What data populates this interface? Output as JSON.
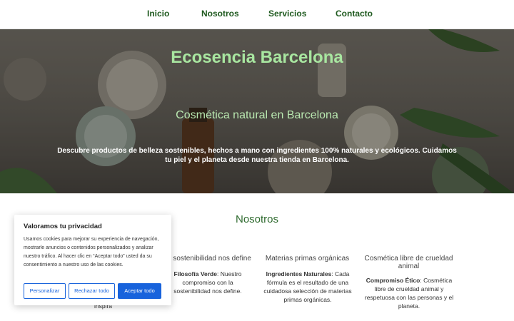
{
  "nav": {
    "items": [
      {
        "label": "Inicio"
      },
      {
        "label": "Nosotros"
      },
      {
        "label": "Servicios"
      },
      {
        "label": "Contacto"
      }
    ]
  },
  "hero": {
    "title": "Ecosencia Barcelona",
    "subtitle": "Cosmética natural en Barcelona",
    "description": "Descubre productos de belleza sostenibles, hechos a mano con ingredientes 100% naturales y ecológicos. Cuidamos tu piel y el planeta desde nuestra tienda en Barcelona."
  },
  "about": {
    "title": "Nosotros",
    "cards": [
      {
        "title": "a sostenibilidad nos define",
        "lead": "Filosofía Verde",
        "text": ": Nuestro compromiso con la sostenibilidad nos define."
      },
      {
        "title": "Materias primas orgánicas",
        "lead": "Ingredientes Naturales",
        "text": ": Cada fórmula es el resultado de una cuidadosa selección de materias primas orgánicas."
      },
      {
        "title": "Cosmética libre de crueldad animal",
        "lead": "Compromiso Ético",
        "text": ": Cosmética libre de crueldad animal y respetuosa con las personas y el planeta."
      }
    ],
    "partial_text": "inspira"
  },
  "cookie": {
    "title": "Valoramos tu privacidad",
    "text": "Usamos cookies para mejorar su experiencia de navegación, mostrarle anuncios o contenidos personalizados y analizar nuestro tráfico. Al hacer clic en “Aceptar todo” usted da su consentimiento a nuestro uso de las cookies.",
    "buttons": {
      "customize": "Personalizar",
      "reject": "Rechazar todo",
      "accept": "Aceptar todo"
    }
  },
  "colors": {
    "nav_text": "#1f5a1f",
    "hero_title": "#a8e6a0",
    "section_title": "#2f6b2f",
    "cookie_accent": "#1863dc"
  }
}
